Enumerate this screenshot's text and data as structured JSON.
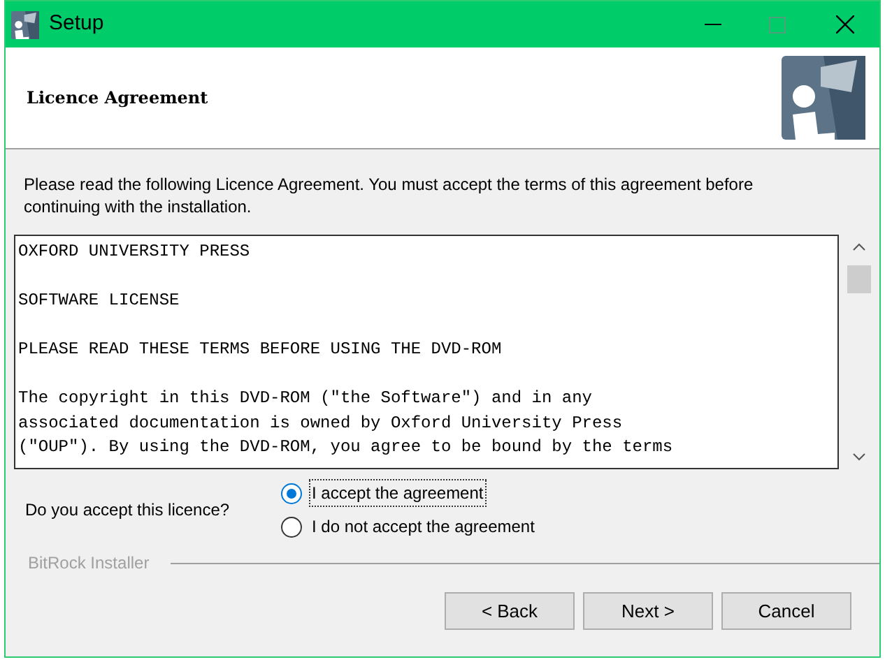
{
  "window": {
    "title": "Setup"
  },
  "header": {
    "title": "Licence Agreement"
  },
  "intro": "Please read the following Licence Agreement. You must accept the terms of this agreement before continuing with the installation.",
  "licence_paragraphs": [
    [
      "OXFORD UNIVERSITY PRESS"
    ],
    [
      "SOFTWARE LICENSE"
    ],
    [
      "PLEASE READ THESE TERMS BEFORE USING THE DVD-ROM"
    ],
    [
      "The copyright in this DVD-ROM (\"the Software\") and in any",
      "associated documentation is owned by Oxford University Press",
      "(\"OUP\"). By using the DVD-ROM, you agree to be bound by the terms"
    ]
  ],
  "question": "Do you accept this licence?",
  "options": [
    {
      "label": "I accept the agreement",
      "selected": true
    },
    {
      "label": "I do not accept the agreement",
      "selected": false
    }
  ],
  "footer_label": "BitRock Installer",
  "buttons": [
    "< Back",
    "Next >",
    "Cancel"
  ]
}
